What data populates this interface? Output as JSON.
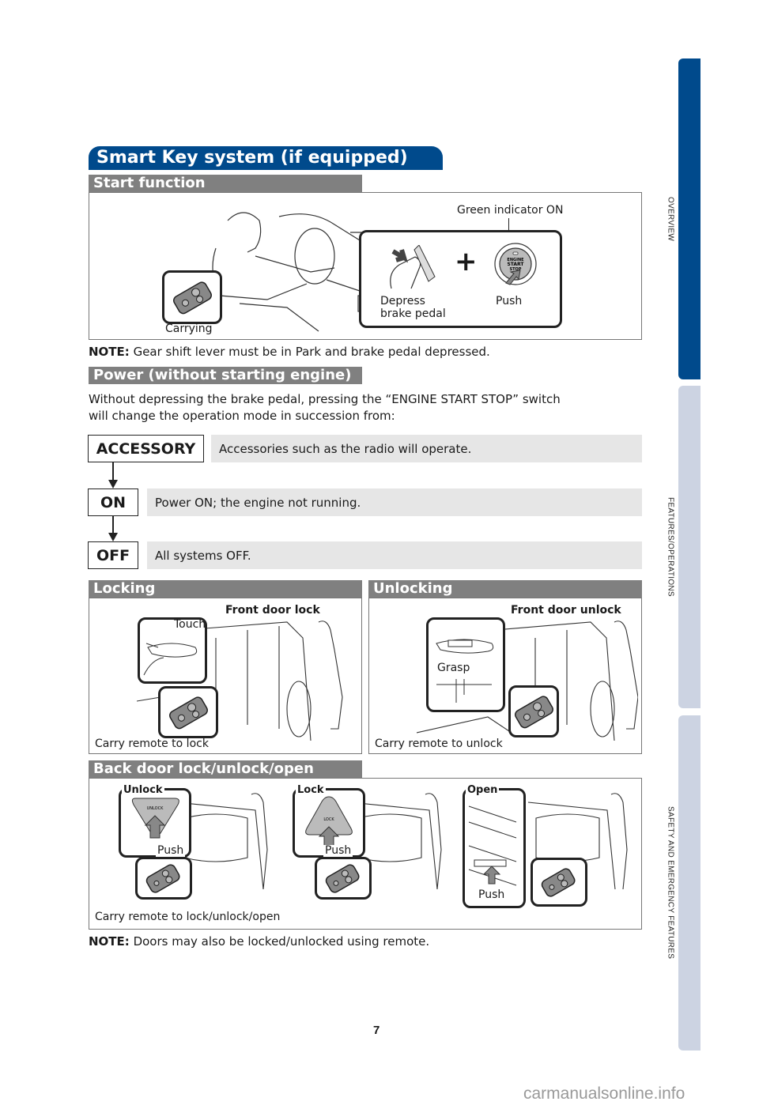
{
  "side_tabs": [
    {
      "label": "OVERVIEW",
      "active": true,
      "color": "#004a8c"
    },
    {
      "label": "FEATURES/OPERATIONS",
      "active": false,
      "color": "#ccd3e2"
    },
    {
      "label": "SAFETY AND EMERGENCY FEATURES",
      "active": false,
      "color": "#ccd3e2"
    }
  ],
  "title": "Smart Key system (if equipped)",
  "start_function": {
    "heading": "Start function",
    "labels": {
      "green_indicator": "Green indicator ON",
      "depress_line1": "Depress",
      "depress_line2": "brake pedal",
      "push": "Push",
      "carrying": "Carrying",
      "plus": "+",
      "button_text": [
        "ENGINE",
        "START",
        "STOP"
      ]
    },
    "note_label": "NOTE:",
    "note_text": "Gear shift lever must be in Park and brake pedal depressed."
  },
  "power": {
    "heading": "Power (without starting engine)",
    "intro_line1": "Without depressing the brake pedal, pressing the “ENGINE START STOP” switch",
    "intro_line2": "will change the operation mode in succession from:",
    "modes": [
      {
        "name": "ACCESSORY",
        "desc": "Accessories such as the radio will operate."
      },
      {
        "name": "ON",
        "desc": "Power ON; the engine not running."
      },
      {
        "name": "OFF",
        "desc": "All systems OFF."
      }
    ]
  },
  "locking": {
    "heading": "Locking",
    "title": "Front door lock",
    "action": "Touch",
    "caption": "Carry remote to lock"
  },
  "unlocking": {
    "heading": "Unlocking",
    "title": "Front door unlock",
    "action": "Grasp",
    "caption": "Carry remote to unlock"
  },
  "back_door": {
    "heading": "Back door lock/unlock/open",
    "panels": [
      {
        "label": "Unlock",
        "action": "Push",
        "button": "UNLOCK"
      },
      {
        "label": "Lock",
        "action": "Push",
        "button": "LOCK"
      },
      {
        "label": "Open",
        "action": "Push"
      }
    ],
    "caption": "Carry remote to lock/unlock/open"
  },
  "footer_note_label": "NOTE:",
  "footer_note_text": "Doors may also be locked/unlocked using remote.",
  "page_number": "7",
  "watermark": "carmanualsonline.info"
}
